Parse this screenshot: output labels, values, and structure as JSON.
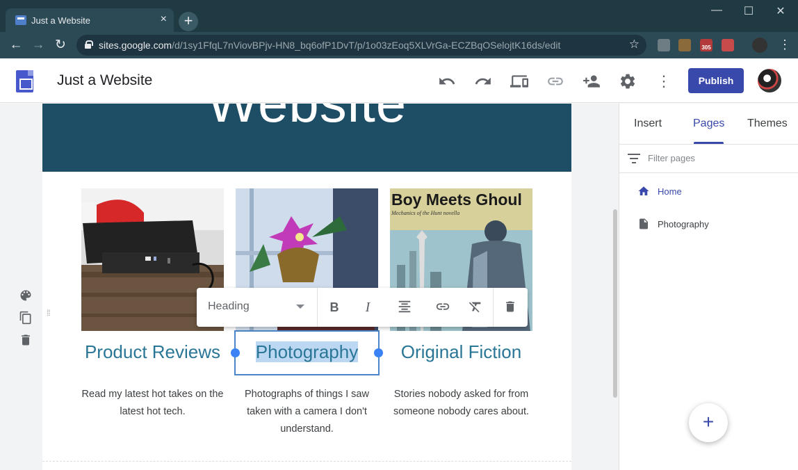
{
  "browser": {
    "tab_title": "Just a Website",
    "tab_close": "×",
    "new_tab": "+",
    "url_host": "sites.google.com",
    "url_path": "/d/1sy1FfqL7nViovBPjv-HN8_bq6ofP1DvT/p/1o03zEoq5XLVrGa-ECZBqOSelojtK16ds/edit",
    "star": "☆",
    "badge": "305"
  },
  "header": {
    "site_name": "Just a Website",
    "publish": "Publish"
  },
  "hero": {
    "title": "Website"
  },
  "cards": [
    {
      "title": "Product Reviews",
      "description": "Read my latest hot takes on the latest hot tech."
    },
    {
      "title": "Photography",
      "description": "Photographs of things I saw taken with a camera I don't understand."
    },
    {
      "title": "Original Fiction",
      "description": "Stories nobody asked for from someone nobody cares about."
    }
  ],
  "image3_text": {
    "title": "Boy Meets Ghoul",
    "subtitle": "Mechanics of the Hunt novella"
  },
  "text_toolbar": {
    "style": "Heading"
  },
  "panel": {
    "tabs": [
      "Insert",
      "Pages",
      "Themes"
    ],
    "active_tab": "Pages",
    "filter_placeholder": "Filter pages",
    "pages": [
      "Home",
      "Photography"
    ]
  },
  "fab": "+",
  "colors": {
    "accent": "#3949ab",
    "hero_bg": "#1d4e65",
    "card_title": "#2a7696",
    "selection": "#4a86c8"
  }
}
